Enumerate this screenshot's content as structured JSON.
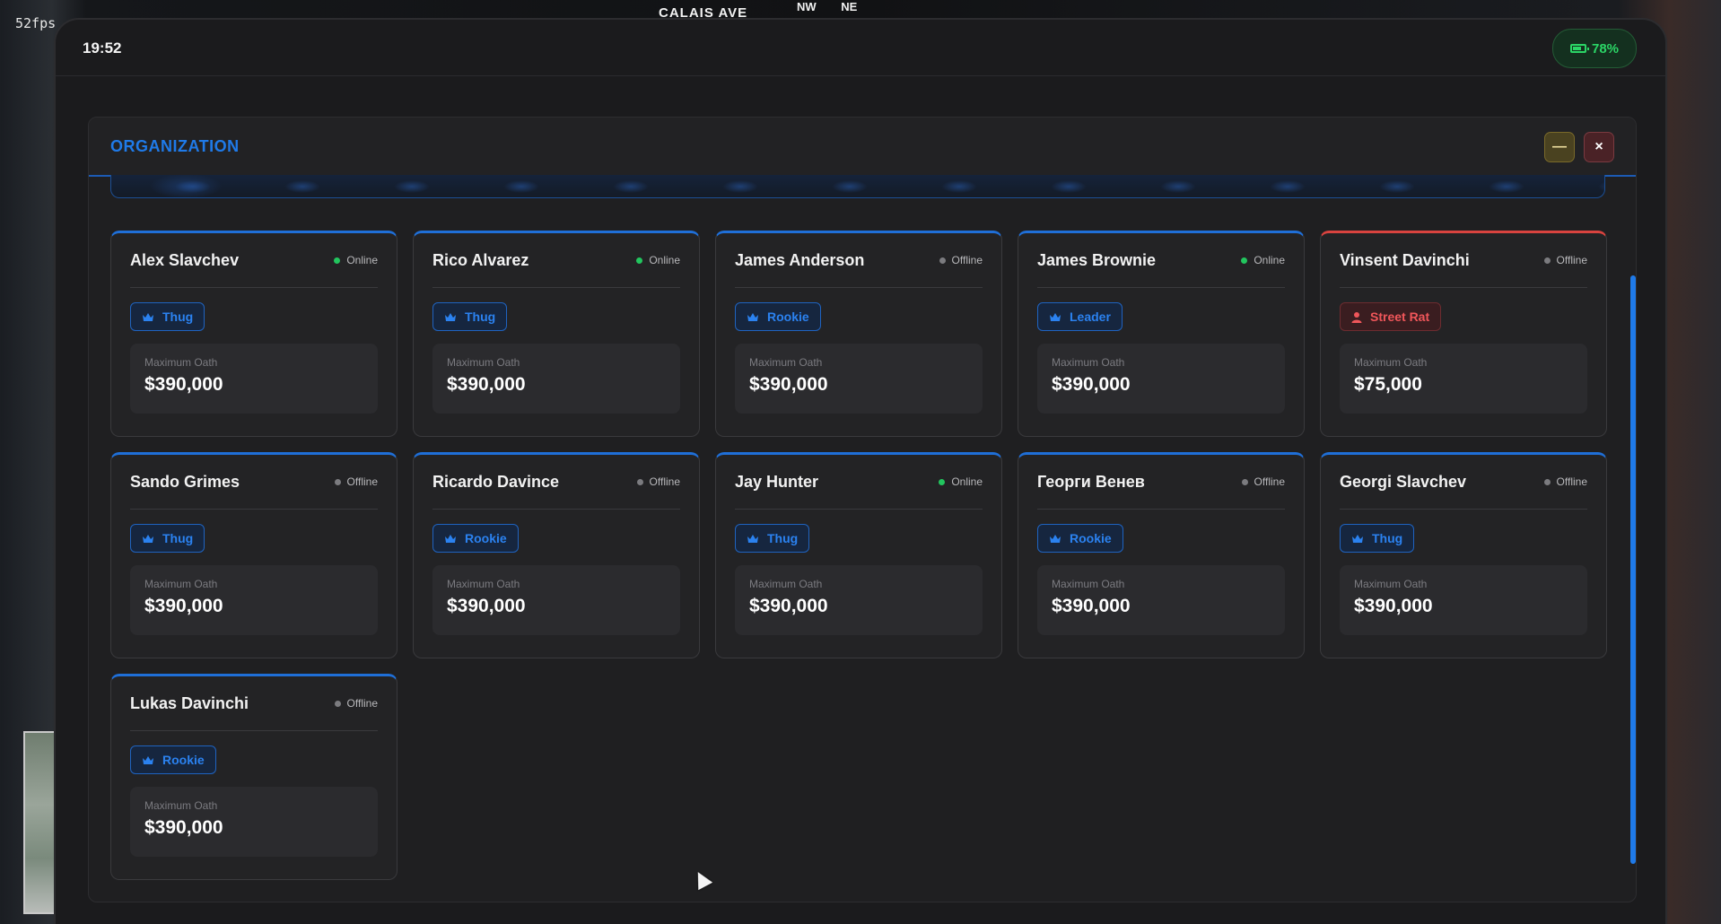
{
  "hud": {
    "fps": "52fps",
    "street": "CALAIS AVE",
    "compass": [
      "NW",
      "NE"
    ]
  },
  "status_bar": {
    "time": "19:52",
    "battery": "78%",
    "battery_level": 0.78,
    "battery_icon": "battery-icon"
  },
  "window": {
    "title": "ORGANIZATION",
    "minimize_label": "—",
    "close_label": "×",
    "accent_color": "#1f7ae8"
  },
  "members": [
    {
      "name": "Alex Slavchev",
      "status": "Online",
      "online": true,
      "rank": "Thug",
      "rank_icon": "crown-icon",
      "oath_label": "Maximum Oath",
      "oath": "$390,000"
    },
    {
      "name": "Rico Alvarez",
      "status": "Online",
      "online": true,
      "rank": "Thug",
      "rank_icon": "crown-icon",
      "oath_label": "Maximum Oath",
      "oath": "$390,000"
    },
    {
      "name": "James Anderson",
      "status": "Offline",
      "online": false,
      "rank": "Rookie",
      "rank_icon": "crown-icon",
      "oath_label": "Maximum Oath",
      "oath": "$390,000"
    },
    {
      "name": "James Brownie",
      "status": "Online",
      "online": true,
      "rank": "Leader",
      "rank_icon": "crown-icon",
      "oath_label": "Maximum Oath",
      "oath": "$390,000"
    },
    {
      "name": "Vinsent Davinchi",
      "status": "Offline",
      "online": false,
      "rank": "Street Rat",
      "rank_icon": "user-icon",
      "danger": true,
      "oath_label": "Maximum Oath",
      "oath": "$75,000"
    },
    {
      "name": "Sando Grimes",
      "status": "Offline",
      "online": false,
      "rank": "Thug",
      "rank_icon": "crown-icon",
      "oath_label": "Maximum Oath",
      "oath": "$390,000"
    },
    {
      "name": "Ricardo Davince",
      "status": "Offline",
      "online": false,
      "rank": "Rookie",
      "rank_icon": "crown-icon",
      "oath_label": "Maximum Oath",
      "oath": "$390,000"
    },
    {
      "name": "Jay Hunter",
      "status": "Online",
      "online": true,
      "rank": "Thug",
      "rank_icon": "crown-icon",
      "oath_label": "Maximum Oath",
      "oath": "$390,000"
    },
    {
      "name": "Георги Венев",
      "status": "Offline",
      "online": false,
      "rank": "Rookie",
      "rank_icon": "crown-icon",
      "oath_label": "Maximum Oath",
      "oath": "$390,000"
    },
    {
      "name": "Georgi Slavchev",
      "status": "Offline",
      "online": false,
      "rank": "Thug",
      "rank_icon": "crown-icon",
      "oath_label": "Maximum Oath",
      "oath": "$390,000"
    },
    {
      "name": "Lukas Davinchi",
      "status": "Offline",
      "online": false,
      "rank": "Rookie",
      "rank_icon": "crown-icon",
      "oath_label": "Maximum Oath",
      "oath": "$390,000"
    }
  ]
}
